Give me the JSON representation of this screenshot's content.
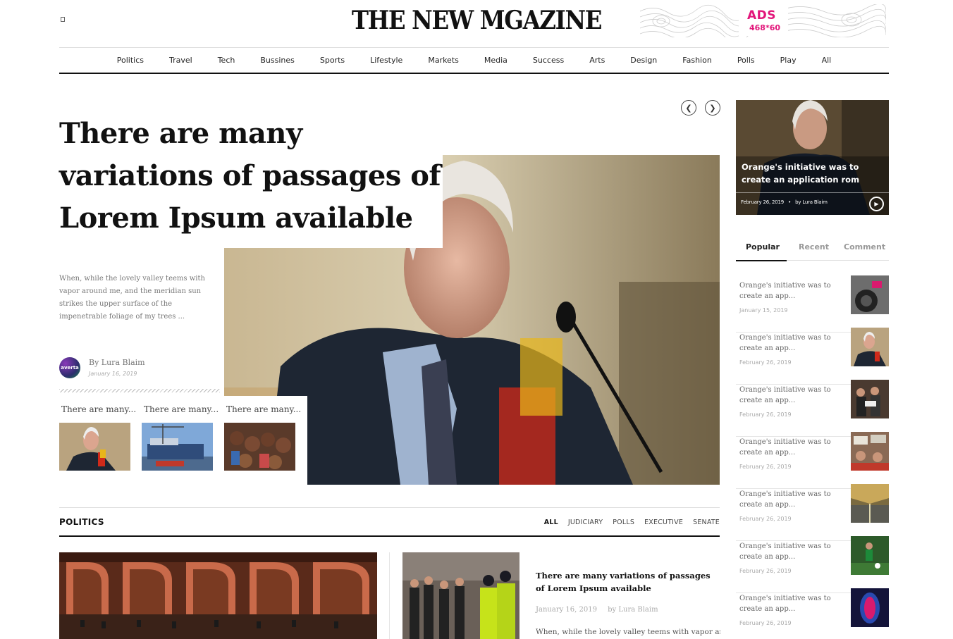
{
  "header": {
    "logo": "THE NEW MGAZINE",
    "ads_title": "ADS",
    "ads_size": "468*60"
  },
  "nav": [
    "Politics",
    "Travel",
    "Tech",
    "Bussines",
    "Sports",
    "Lifestyle",
    "Markets",
    "Media",
    "Success",
    "Arts",
    "Design",
    "Fashion",
    "Polls",
    "Play",
    "All"
  ],
  "hero": {
    "title_line1": "There are many",
    "title_line2": "variations of passages of",
    "title_line3": "Lorem Ipsum available",
    "excerpt": "When, while the lovely valley teems with vapor around me, and the meridian sun strikes the upper surface of the impenetrable foliage of my trees ...",
    "avatar_text": "averta",
    "author": "By Lura Blaim",
    "date": "January 16, 2019",
    "prev_icon": "chevron-left-icon",
    "next_icon": "chevron-right-icon",
    "thumbs": [
      {
        "title": "There are many..."
      },
      {
        "title": "There are many..."
      },
      {
        "title": "There are many..."
      }
    ]
  },
  "side_feature": {
    "title": "Orange's initiative was to create an application rom",
    "date": "February 26, 2019",
    "separator": "•",
    "author": "by Lura Blaim",
    "play_icon": "play-icon"
  },
  "tabs": [
    "Popular",
    "Recent",
    "Comment"
  ],
  "side_list": [
    {
      "title": "Orange's initiative was to create an app...",
      "date": "January 15, 2019"
    },
    {
      "title": "Orange's initiative was to create an app...",
      "date": "February 26, 2019"
    },
    {
      "title": "Orange's initiative was to create an app...",
      "date": "February 26, 2019"
    },
    {
      "title": "Orange's initiative was to create an app...",
      "date": "February 26, 2019"
    },
    {
      "title": "Orange's initiative was to create an app...",
      "date": "February 26, 2019"
    },
    {
      "title": "Orange's initiative was to create an app...",
      "date": "February 26, 2019"
    },
    {
      "title": "Orange's initiative was to create an app...",
      "date": "February 26, 2019"
    }
  ],
  "politics": {
    "title": "POLITICS",
    "filters": [
      "ALL",
      "JUDICIARY",
      "POLLS",
      "EXECUTIVE",
      "SENATE"
    ],
    "article_title": "There are many variations of passages of Lorem Ipsum available",
    "article_date": "January 16, 2019",
    "article_author": "by Lura Blaim",
    "article_excerpt": "When, while the lovely valley teems with vapor around"
  },
  "colors": {
    "accent": "#e2157a",
    "text": "#111111",
    "muted": "#777777"
  }
}
